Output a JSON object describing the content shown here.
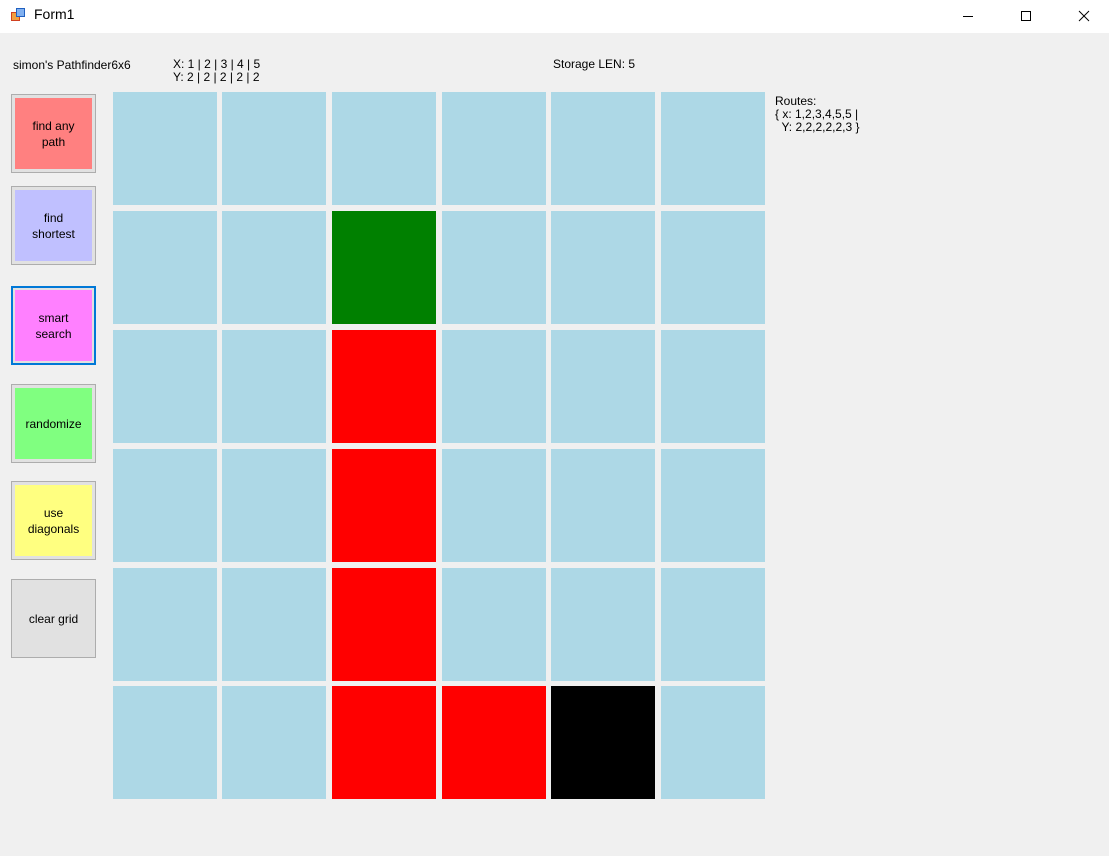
{
  "window": {
    "title": "Form1"
  },
  "header": {
    "app_label": "simon's Pathfinder6x6",
    "xy_label": "X: 1 | 2 | 3 | 4 | 5\nY: 2 | 2 | 2 | 2 | 2",
    "storage_label": "Storage LEN: 5",
    "routes_label": "Routes:\n{ x: 1,2,3,4,5,5 |\n  Y: 2,2,2,2,2,3 }"
  },
  "buttons": [
    {
      "label": "find any\npath",
      "color": "#ff8080"
    },
    {
      "label": "find\nshortest",
      "color": "#c0c0ff"
    },
    {
      "label": "smart\nsearch",
      "color": "#ff80ff"
    },
    {
      "label": "randomize",
      "color": "#80ff80"
    },
    {
      "label": "use\ndiagonals",
      "color": "#ffff80"
    },
    {
      "label": "clear grid",
      "color": "#e1e1e1"
    }
  ],
  "grid": {
    "rows": 6,
    "cols": 6,
    "colors": {
      "empty": "#add8e6",
      "start": "#008000",
      "path": "#ff0000",
      "end": "#000000"
    },
    "cells": [
      [
        "empty",
        "empty",
        "empty",
        "empty",
        "empty",
        "empty"
      ],
      [
        "empty",
        "empty",
        "start",
        "empty",
        "empty",
        "empty"
      ],
      [
        "empty",
        "empty",
        "path",
        "empty",
        "empty",
        "empty"
      ],
      [
        "empty",
        "empty",
        "path",
        "empty",
        "empty",
        "empty"
      ],
      [
        "empty",
        "empty",
        "path",
        "empty",
        "empty",
        "empty"
      ],
      [
        "empty",
        "empty",
        "path",
        "path",
        "end",
        "empty"
      ]
    ]
  }
}
